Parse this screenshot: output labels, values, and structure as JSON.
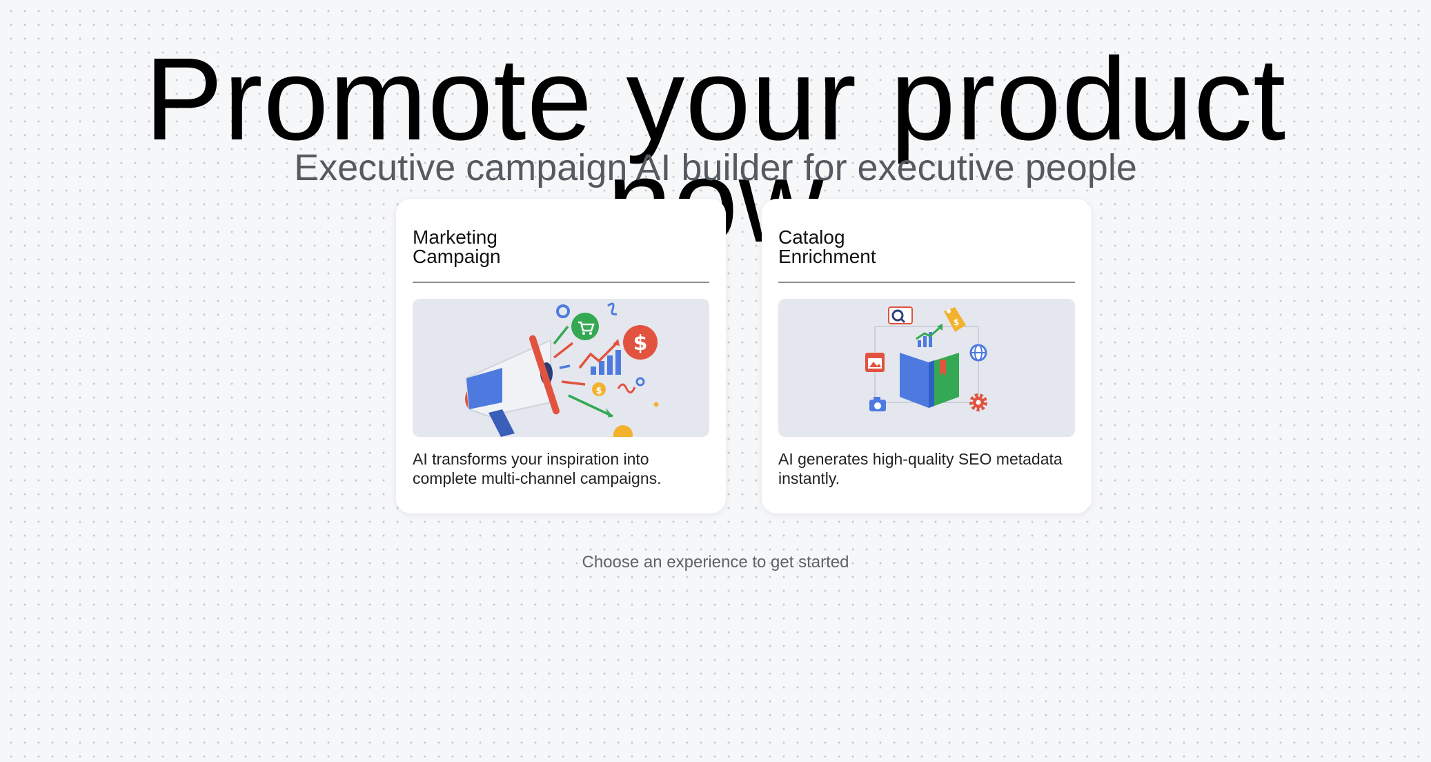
{
  "hero": {
    "headline": "Promote your product now",
    "subtitle": "Executive campaign AI builder for executive people"
  },
  "cards": [
    {
      "title": "Marketing Campaign",
      "description": "AI transforms your inspiration into complete multi-channel campaigns.",
      "illustration": "megaphone-illustration"
    },
    {
      "title": "Catalog Enrichment",
      "description": "AI generates high-quality SEO metadata instantly.",
      "illustration": "catalog-book-illustration"
    }
  ],
  "hint": "Choose an experience to get started",
  "colors": {
    "background": "#f6f7f9",
    "card": "#ffffff",
    "image_bg": "#e4e7ee",
    "blue": "#4e7ae0",
    "red": "#e2533f",
    "green": "#34a853",
    "yellow": "#f3b22e"
  }
}
